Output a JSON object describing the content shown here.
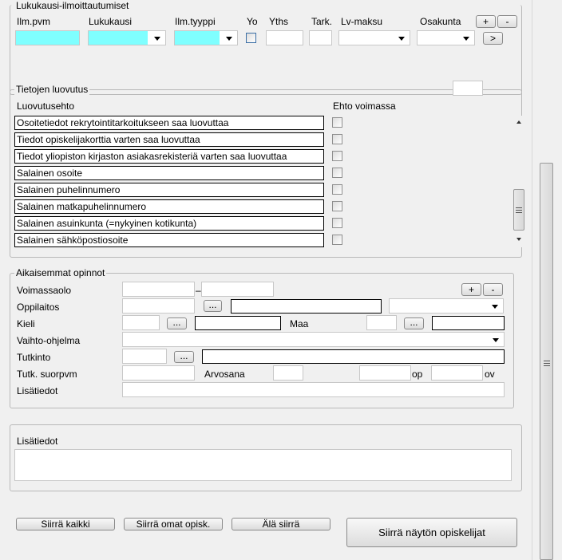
{
  "lukukausi": {
    "legend": "Lukukausi-ilmoittautumiset",
    "headers": {
      "ilm_pvm": "Ilm.pvm",
      "lukukausi": "Lukukausi",
      "ilm_tyyppi": "Ilm.tyyppi",
      "yo": "Yo",
      "yths": "Yths",
      "tark": "Tark.",
      "lv_maksu": "Lv-maksu",
      "osakunta": "Osakunta"
    },
    "plus_label": "+",
    "minus_label": "-",
    "next_label": ">"
  },
  "luovutus": {
    "legend": "Tietojen luovutus",
    "col_condition": "Luovutusehto",
    "col_valid": "Ehto voimassa",
    "items": [
      "Osoitetiedot rekrytointitarkoitukseen saa luovuttaa",
      "Tiedot opiskelijakorttia varten saa luovuttaa",
      "Tiedot yliopiston kirjaston asiakasrekisteriä varten saa luovuttaa",
      "Salainen osoite",
      "Salainen puhelinnumero",
      "Salainen matkapuhelinnumero",
      "Salainen asuinkunta (=nykyinen kotikunta)",
      "Salainen sähköpostiosoite"
    ]
  },
  "aikaisemmat": {
    "legend": "Aikaisemmat opinnot",
    "voimassaolo": "Voimassaolo",
    "dash": "–",
    "oppilaitos": "Oppilaitos",
    "kieli": "Kieli",
    "maa": "Maa",
    "vaihto": "Vaihto-ohjelma",
    "tutkinto": "Tutkinto",
    "suorpvm": "Tutk. suorpvm",
    "arvosana": "Arvosana",
    "op": "op",
    "ov": "ov",
    "lisatiedot": "Lisätiedot",
    "ellipsis": "...",
    "plus_label": "+",
    "minus_label": "-"
  },
  "lisatiedot": {
    "label": "Lisätiedot"
  },
  "buttons": {
    "siirra_kaikki": "Siirrä kaikki",
    "siirra_omat": "Siirrä omat opisk.",
    "ala_siirra": "Älä siirrä",
    "siirra_nayton": "Siirrä näytön opiskelijat"
  },
  "colors": {
    "required": "#7fffff",
    "background": "#f0f0f0"
  }
}
